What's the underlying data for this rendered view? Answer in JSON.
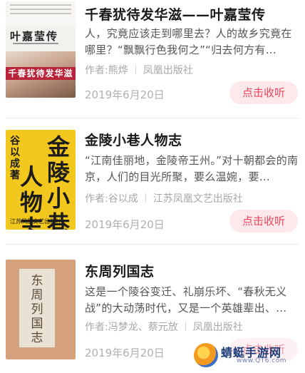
{
  "listen_label": "点击收听",
  "books": [
    {
      "title": "千春犹待发华滋——叶嘉莹传",
      "description": "人，究竟应该走到哪里去？人的故乡究竟在哪里？“飘飘行色我何之”“归去何方有…",
      "author": "作者:熊烨",
      "publisher": "凤凰出版社",
      "date": "2019年6月20日",
      "cover": {
        "title": "叶嘉莹传",
        "banner": "千春犹待发华滋"
      }
    },
    {
      "title": "金陵小巷人物志",
      "description": "“江南佳丽地，金陵帝王州。”对十朝都会的南京，人们的目光所聚，要么温婉，要…",
      "author": "作者:谷以成",
      "publisher": "江苏凤凰文艺出版社",
      "date": "2019年6月20日",
      "cover": {
        "small": "谷以成著",
        "col1": "人物志",
        "col2": "金陵小巷",
        "publisher": "江苏凤凰文艺出版社"
      }
    },
    {
      "title": "东周列国志",
      "description": "这是一个陵谷变迁、礼崩乐坏、“春秋无义战”的大动荡时代，又是一个英雄辈出、…",
      "author": "作者:冯梦龙、蔡元放",
      "publisher": "凤凰出版社",
      "date": "2019年6月20日",
      "cover": {
        "vertical": "东周列国志"
      }
    }
  ],
  "watermark": {
    "name": "蜻蜓手游网",
    "url": "www.QT6.com"
  },
  "colors": {
    "accent": "#e9475e",
    "button_bg": "#fde9ec"
  }
}
